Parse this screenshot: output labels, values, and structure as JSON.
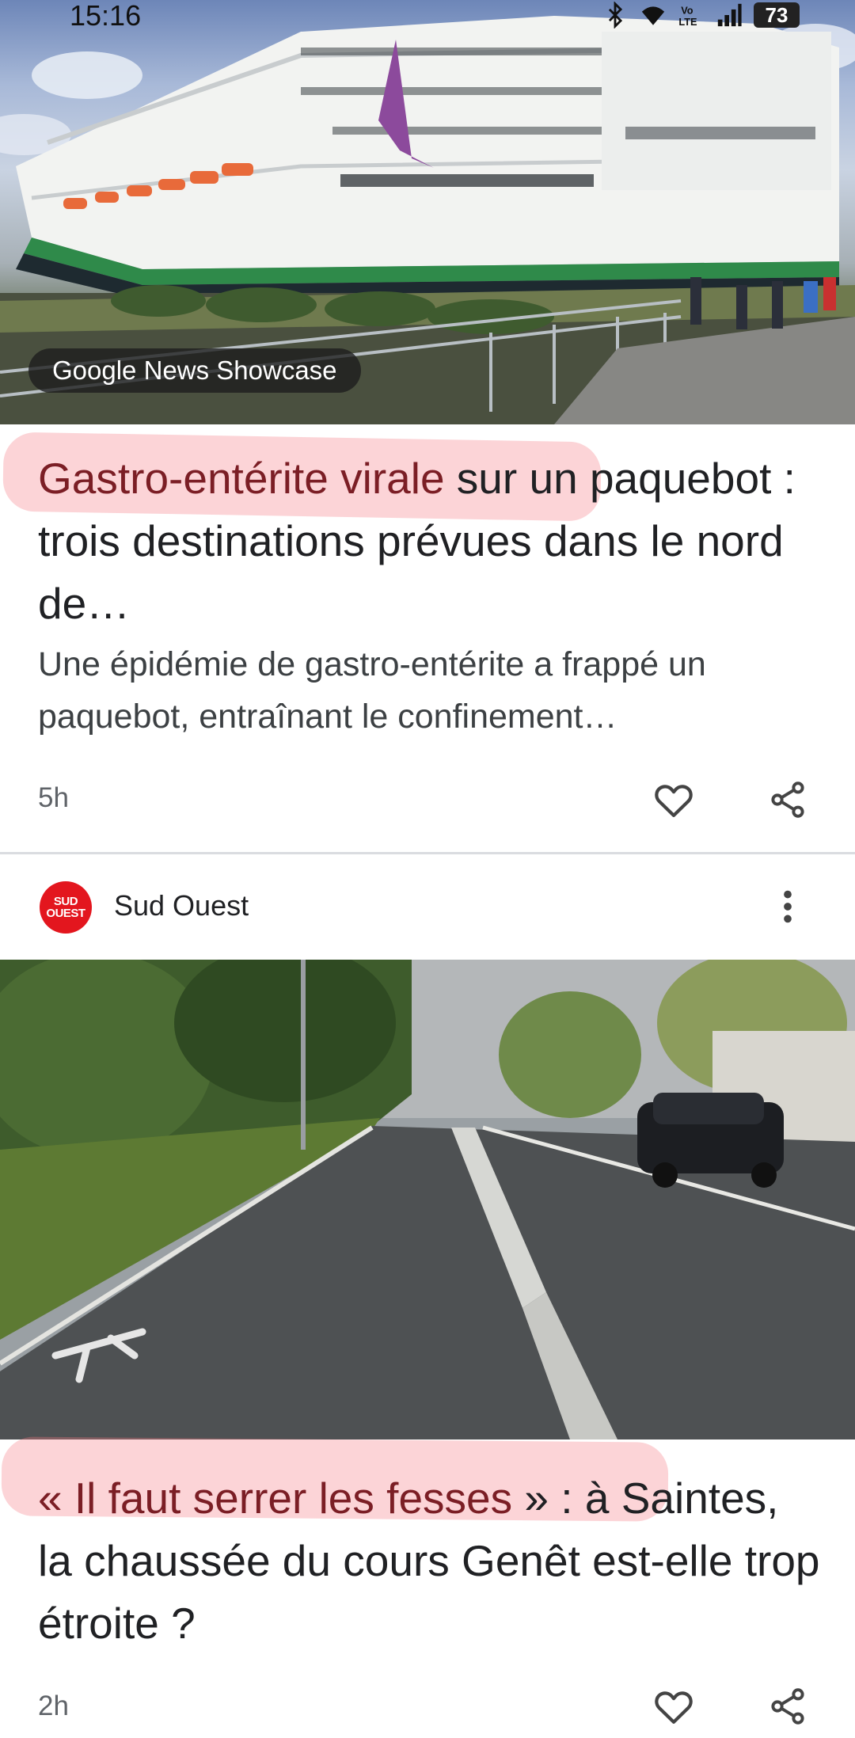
{
  "status_bar": {
    "time": "15:16",
    "battery": "73",
    "icons": [
      "bluetooth-icon",
      "wifi-icon",
      "volte-icon",
      "signal-icon",
      "battery-icon"
    ]
  },
  "article1": {
    "badge": "Google News Showcase",
    "headline_highlighted": "Gastro-entérite virale",
    "headline_rest": " sur un paquebot : trois destinations prévues dans le nord de…",
    "snippet": "Une épidémie de gastro-entérite a frappé un paquebot, entraînant le confinement…",
    "time": "5h",
    "actions": [
      "heart-icon",
      "share-icon"
    ]
  },
  "publisher": {
    "logo_line1": "SUD",
    "logo_line2": "OUEST",
    "name": "Sud Ouest",
    "menu_icon": "more-vert-icon"
  },
  "article2": {
    "headline_highlighted": "« Il faut serrer les fesses",
    "headline_rest": " » : à Saintes, la chaussée du cours Genêt est-elle trop étroite ?",
    "time": "2h",
    "actions": [
      "heart-icon",
      "share-icon"
    ]
  },
  "colors": {
    "highlight": "#f67882",
    "publisher_brand": "#e3161e",
    "divider": "#dadce0",
    "meta_text": "#5f6368"
  }
}
